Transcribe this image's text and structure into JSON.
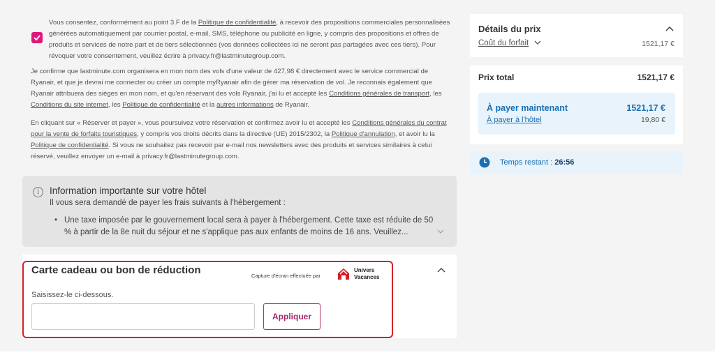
{
  "consent": {
    "p1_a": "Vous consentez, conformément au point 3.F de la ",
    "p1_link": "Politique de confidentialité",
    "p1_b": ", à recevoir des propositions commerciales personnalisées générées automatiquement par courrier postal, e-mail, SMS, téléphone ou publicité en ligne, y compris des propositions et offres de produits et services de notre part et de tiers sélectionnés (vos données collectées ici ne seront pas partagées avec ces tiers). Pour révoquer votre consentement, veuillez écrire à privacy.fr@lastminutegroup.com.",
    "p2_a": "Je confirme que lastminute.com organisera en mon nom des vols d'une valeur de 427,98 € directement avec le service commercial de Ryanair, et que je devrai me connecter ou créer un compte myRyanair afin de gérer ma réservation de vol. Je reconnais également que Ryanair attribuera des sièges en mon nom, et qu'en réservant des vols Ryanair, j'ai lu et accepté les ",
    "p2_link1": "Conditions générales de transport",
    "p2_b": ", les ",
    "p2_link2": "Conditions du site internet",
    "p2_c": ", les ",
    "p2_link3": "Politique de confidentialité",
    "p2_d": " et la ",
    "p2_link4": "autres informations",
    "p2_e": " de Ryanair.",
    "p3_a": "En cliquant sur « Réserver et payer », vous poursuivez votre réservation et confirmez avoir lu et accepté les ",
    "p3_link1": "Conditions générales du contrat pour la vente de forfaits touristiques",
    "p3_b": ", y compris vos droits décrits dans la directive (UE) 2015/2302, la ",
    "p3_link2": "Politique d'annulation",
    "p3_c": ", et avoir lu la ",
    "p3_link3": "Politique de confidentialité",
    "p3_d": ". Si vous ne souhaitez pas recevoir par e-mail nos newsletters avec des produits et services similaires à celui réservé, veuillez envoyer un e-mail à privacy.fr@lastminutegroup.com."
  },
  "hotel_info": {
    "title": "Information importante sur votre hôtel",
    "subtitle": "Il vous sera demandé de payer les frais suivants à l'hébergement :",
    "bullet": "Une taxe imposée par le gouvernement local sera à payer à l'hébergement. Cette taxe est réduite de 50 % à partir de la 8e nuit du séjour et ne s'applique pas aux enfants de moins de 16 ans. Veuillez..."
  },
  "gift": {
    "title": "Carte cadeau ou bon de réduction",
    "capture_text": "Capture d'écran effectuée par",
    "brand_line1": "Univers",
    "brand_line2": "Vacances",
    "label": "Saisissez-le ci-dessous.",
    "input_value": "",
    "apply_label": "Appliquer"
  },
  "price": {
    "title": "Détails du prix",
    "forfait_label": "Coût du forfait",
    "forfait_amount": "1521,17 €",
    "total_label": "Prix total",
    "total_amount": "1521,17 €",
    "pay_now_label": "À payer maintenant",
    "pay_now_amount": "1521,17 €",
    "pay_hotel_label": "À payer à l'hôtel",
    "pay_hotel_amount": "19,80 €"
  },
  "timer": {
    "label": "Temps restant : ",
    "value": "26:56"
  },
  "colors": {
    "accent_pink": "#e0167c",
    "blue": "#1a6fb3",
    "highlight_red": "#d42128"
  },
  "icons": {
    "checkbox": "check-icon",
    "info": "info-icon",
    "clock": "clock-icon",
    "chevron_up": "chevron-up-icon",
    "chevron_down": "chevron-down-icon"
  }
}
